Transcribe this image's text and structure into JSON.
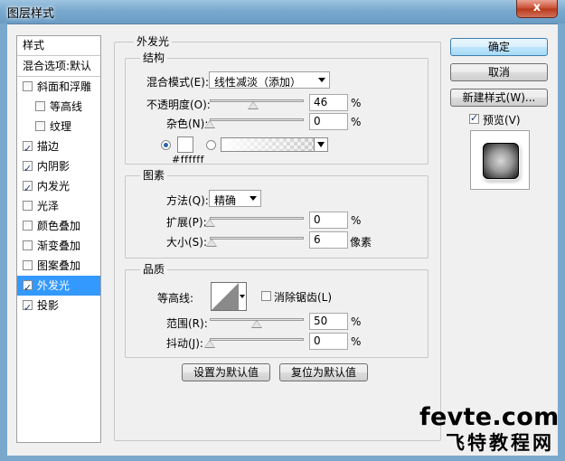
{
  "window": {
    "title": "图层样式",
    "close_label": "x"
  },
  "style_list": {
    "header": "样式",
    "blend_options": "混合选项:默认",
    "items": [
      {
        "label": "斜面和浮雕",
        "checked": false,
        "sub": false,
        "selected": false
      },
      {
        "label": "等高线",
        "checked": false,
        "sub": true,
        "selected": false
      },
      {
        "label": "纹理",
        "checked": false,
        "sub": true,
        "selected": false
      },
      {
        "label": "描边",
        "checked": true,
        "sub": false,
        "selected": false
      },
      {
        "label": "内阴影",
        "checked": true,
        "sub": false,
        "selected": false
      },
      {
        "label": "内发光",
        "checked": true,
        "sub": false,
        "selected": false
      },
      {
        "label": "光泽",
        "checked": false,
        "sub": false,
        "selected": false
      },
      {
        "label": "颜色叠加",
        "checked": false,
        "sub": false,
        "selected": false
      },
      {
        "label": "渐变叠加",
        "checked": false,
        "sub": false,
        "selected": false
      },
      {
        "label": "图案叠加",
        "checked": false,
        "sub": false,
        "selected": false
      },
      {
        "label": "外发光",
        "checked": true,
        "sub": false,
        "selected": true
      },
      {
        "label": "投影",
        "checked": true,
        "sub": false,
        "selected": false
      }
    ]
  },
  "outer_glow": {
    "title": "外发光",
    "structure": {
      "title": "结构",
      "blend_mode_label": "混合模式(E):",
      "blend_mode_value": "线性减淡（添加）",
      "opacity_label": "不透明度(O):",
      "opacity_value": "46",
      "opacity_unit": "%",
      "opacity_level": 0.46,
      "noise_label": "杂色(N):",
      "noise_value": "0",
      "noise_unit": "%",
      "noise_level": 0,
      "color_hex": "#ffffff"
    },
    "elements": {
      "title": "图素",
      "technique_label": "方法(Q):",
      "technique_value": "精确",
      "spread_label": "扩展(P):",
      "spread_value": "0",
      "spread_unit": "%",
      "spread_level": 0,
      "size_label": "大小(S):",
      "size_value": "6",
      "size_unit": "像素",
      "size_level": 0.024
    },
    "quality": {
      "title": "品质",
      "contour_label": "等高线:",
      "antialias_label": "消除锯齿(L)",
      "antialias_checked": false,
      "range_label": "范围(R):",
      "range_value": "50",
      "range_unit": "%",
      "range_level": 0.5,
      "jitter_label": "抖动(J):",
      "jitter_value": "0",
      "jitter_unit": "%",
      "jitter_level": 0
    },
    "make_default_label": "设置为默认值",
    "reset_default_label": "复位为默认值"
  },
  "side_buttons": {
    "ok": "确定",
    "cancel": "取消",
    "new_style": "新建样式(W)...",
    "preview_label": "预览(V)",
    "preview_checked": true
  },
  "watermark": {
    "top": "fevte.com",
    "bottom": "飞特教程网"
  }
}
